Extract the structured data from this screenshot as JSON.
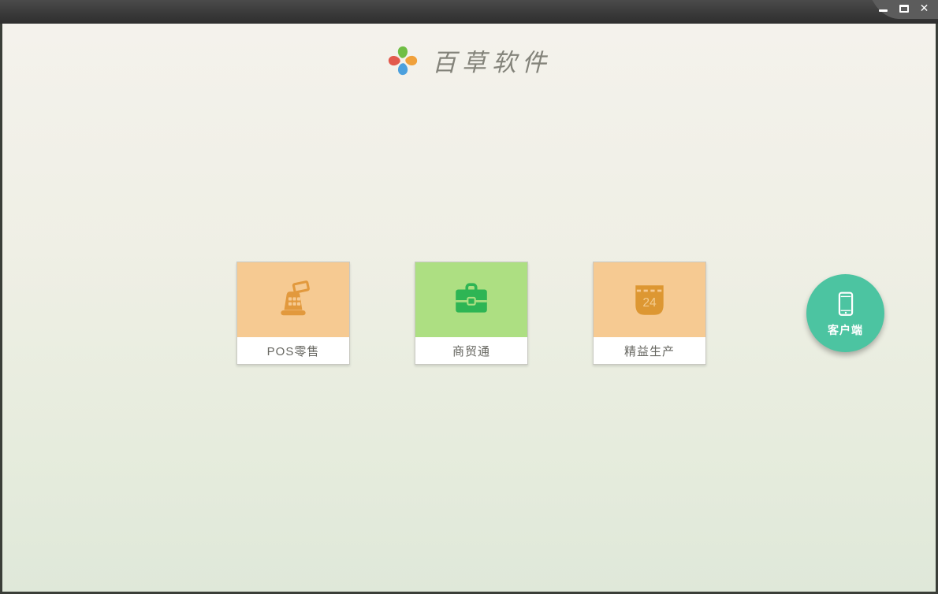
{
  "titlebar": {
    "controls": {
      "minimize": {
        "name": "minimize",
        "glyph": "css-bar"
      },
      "maximize": {
        "name": "maximize",
        "glyph": "css-box"
      },
      "close": {
        "name": "close",
        "glyph": "✕"
      }
    }
  },
  "header": {
    "app_title": "百草软件",
    "logo": "pinwheel-logo"
  },
  "products": [
    {
      "label": "POS零售",
      "icon": "cash-register-icon",
      "tile_bg": "#f6ca92",
      "icon_color": "#e2993d"
    },
    {
      "label": "商贸通",
      "icon": "briefcase-icon",
      "tile_bg": "#addf82",
      "icon_color": "#2eb554"
    },
    {
      "label": "精益生产",
      "icon": "calendar-icon",
      "tile_bg": "#f6ca92",
      "icon_color": "#dd9732",
      "day": "24"
    }
  ],
  "client": {
    "label": "客户端",
    "icon": "smartphone-icon",
    "bg": "#4cc4a1"
  },
  "colors": {
    "titlebar_top": "#4b4b4b",
    "titlebar_bottom": "#2e2e2e",
    "corner_tab": "#5c5c5c",
    "window_border": "#3a3e38",
    "bg_top": "#f4f2ec",
    "bg_bottom": "#dfe8d9",
    "card_label_text": "#666660",
    "brand_title_text": "#83837a",
    "logo_petal_green": "#6fbe44",
    "logo_petal_orange": "#f0a13b",
    "logo_petal_blue": "#4ba0dd",
    "logo_petal_red": "#e25a4d"
  }
}
